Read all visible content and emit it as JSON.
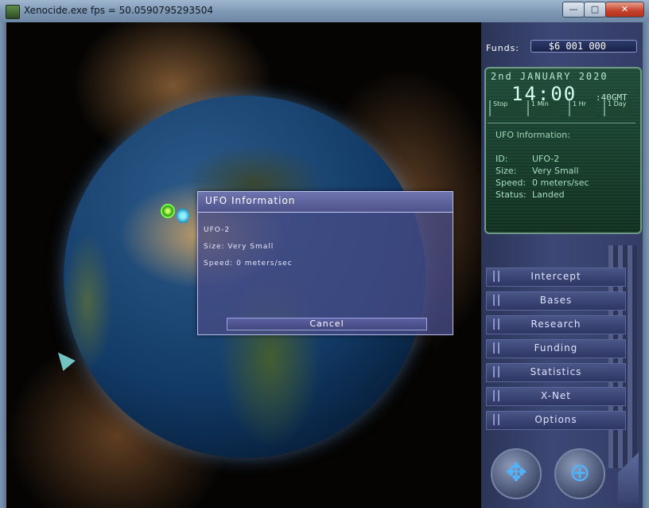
{
  "window": {
    "title": "Xenocide.exe  fps = 50.0590795293504",
    "min_glyph": "—",
    "max_glyph": "□",
    "close_glyph": "✕"
  },
  "ufo_popup": {
    "title": "UFO Information",
    "lines": [
      "UFO-2",
      "Size: Very Small",
      "Speed: 0 meters/sec"
    ],
    "cancel_label": "Cancel"
  },
  "panel": {
    "funds_label": "Funds:",
    "funds_value": "$6 001 000",
    "date": "2nd JANUARY 2020",
    "time": "14:00",
    "seconds": ":40GMT",
    "speed_buttons": [
      "Stop",
      "1 Min",
      "1 Hr",
      "1 Day"
    ],
    "info": {
      "title": "UFO Information:",
      "rows": [
        {
          "label": "ID:",
          "value": "UFO-2"
        },
        {
          "label": "Size:",
          "value": "Very Small"
        },
        {
          "label": "Speed:",
          "value": "0 meters/sec"
        },
        {
          "label": "Status:",
          "value": "Landed"
        }
      ]
    },
    "menu": [
      "Intercept",
      "Bases",
      "Research",
      "Funding",
      "Statistics",
      "X-Net",
      "Options"
    ],
    "globe_controls": {
      "rotate_glyph": "✥",
      "zoom_glyph": "⊕"
    }
  },
  "colors": {
    "accent": "#4d528a",
    "clock_green": "#10301f",
    "ufo_marker": "#3fb41f",
    "base_marker": "#1f8fc0"
  }
}
